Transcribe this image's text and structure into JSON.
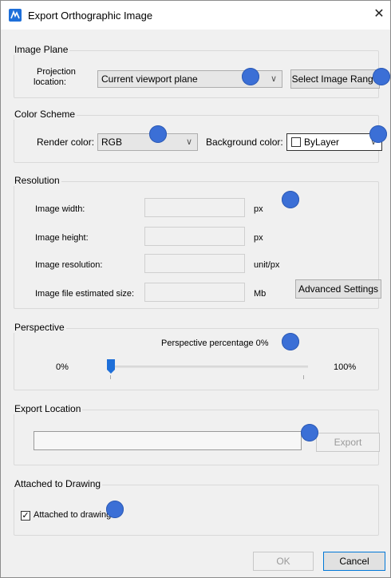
{
  "window": {
    "title": "Export Orthographic Image",
    "close_glyph": "✕"
  },
  "image_plane": {
    "group_label": "Image Plane",
    "projection_label_line1": "Projection",
    "projection_label_line2": "location:",
    "projection_value": "Current viewport plane",
    "select_range_label": "Select Image Range"
  },
  "color_scheme": {
    "group_label": "Color Scheme",
    "render_label": "Render color:",
    "render_value": "RGB",
    "background_label": "Background color:",
    "background_value": "ByLayer"
  },
  "resolution": {
    "group_label": "Resolution",
    "width_label": "Image width:",
    "width_unit": "px",
    "height_label": "Image height:",
    "height_unit": "px",
    "res_label": "Image resolution:",
    "res_unit": "unit/px",
    "size_label": "Image file estimated size:",
    "size_unit": "Mb",
    "advanced_label": "Advanced Settings"
  },
  "perspective": {
    "group_label": "Perspective",
    "percentage_label": "Perspective percentage 0%",
    "min_label": "0%",
    "max_label": "100%",
    "value_percent": 0
  },
  "export_location": {
    "group_label": "Export Location",
    "path_value": "",
    "export_label": "Export"
  },
  "attached": {
    "group_label": "Attached to Drawing",
    "checkbox_label": "Attached to drawing",
    "checked": true
  },
  "footer": {
    "ok_label": "OK",
    "cancel_label": "Cancel"
  },
  "colors": {
    "accent_dot": "#3b6fd6",
    "window_bg": "#f0f0f0"
  }
}
